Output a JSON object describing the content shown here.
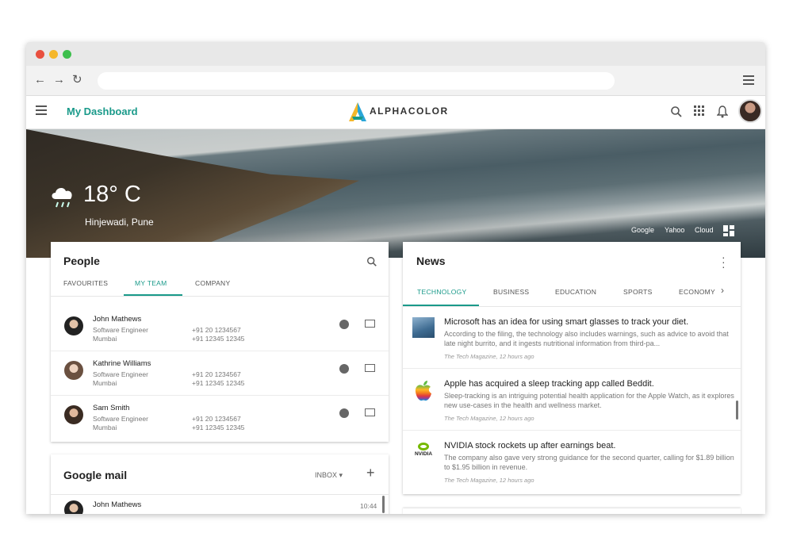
{
  "colors": {
    "accent": "#1a9a8a",
    "dot_red": "#e9503f",
    "dot_yellow": "#f5b72a",
    "dot_green": "#3dbf4d"
  },
  "header": {
    "title": "My Dashboard",
    "brand": "ALPHACOLOR"
  },
  "hero": {
    "temperature": "18° C",
    "location": "Hinjewadi, Pune",
    "links": [
      "Google",
      "Yahoo",
      "Cloud"
    ]
  },
  "people": {
    "title": "People",
    "tabs": [
      "FAVOURITES",
      "MY TEAM",
      "COMPANY"
    ],
    "active_tab": "MY TEAM",
    "items": [
      {
        "name": "John Mathews",
        "role": "Software Engineer",
        "city": "Mumbai",
        "phone1": "+91 20 1234567",
        "phone2": "+91 12345 12345"
      },
      {
        "name": "Kathrine Williams",
        "role": "Software Engineer",
        "city": "Mumbai",
        "phone1": "+91 20 1234567",
        "phone2": "+91 12345 12345"
      },
      {
        "name": "Sam Smith",
        "role": "Software Engineer",
        "city": "Mumbai",
        "phone1": "+91 20 1234567",
        "phone2": "+91 12345 12345"
      }
    ]
  },
  "mail": {
    "title": "Google mail",
    "folder": "INBOX",
    "first_sender": "John Mathews",
    "first_time": "10:44"
  },
  "news": {
    "title": "News",
    "tabs": [
      "TECHNOLOGY",
      "BUSINESS",
      "EDUCATION",
      "SPORTS",
      "ECONOMY"
    ],
    "active_tab": "TECHNOLOGY",
    "items": [
      {
        "icon": "microsoft-thumbnail",
        "title": "Microsoft has an idea for using smart glasses to track your diet.",
        "body": "According to the filing, the technology also includes warnings, such as advice to avoid that late night burrito, and it ingests nutritional information from third-pa...",
        "source": "The Tech Magazine, 12 hours ago"
      },
      {
        "icon": "apple-logo",
        "title": "Apple has acquired a sleep tracking app called Beddit.",
        "body": "Sleep-tracking is an intriguing potential health application for the Apple Watch, as it explores new use-cases in the health and wellness market.",
        "source": "The Tech Magazine, 12 hours ago"
      },
      {
        "icon": "nvidia-logo",
        "icon_label": "NVIDIA",
        "title": "NVIDIA stock rockets up after earnings beat.",
        "body": "The company also gave very strong guidance for the second quarter, calling for $1.89 billion to $1.95 billion in revenue.",
        "source": "The Tech Magazine, 12 hours ago"
      }
    ]
  }
}
